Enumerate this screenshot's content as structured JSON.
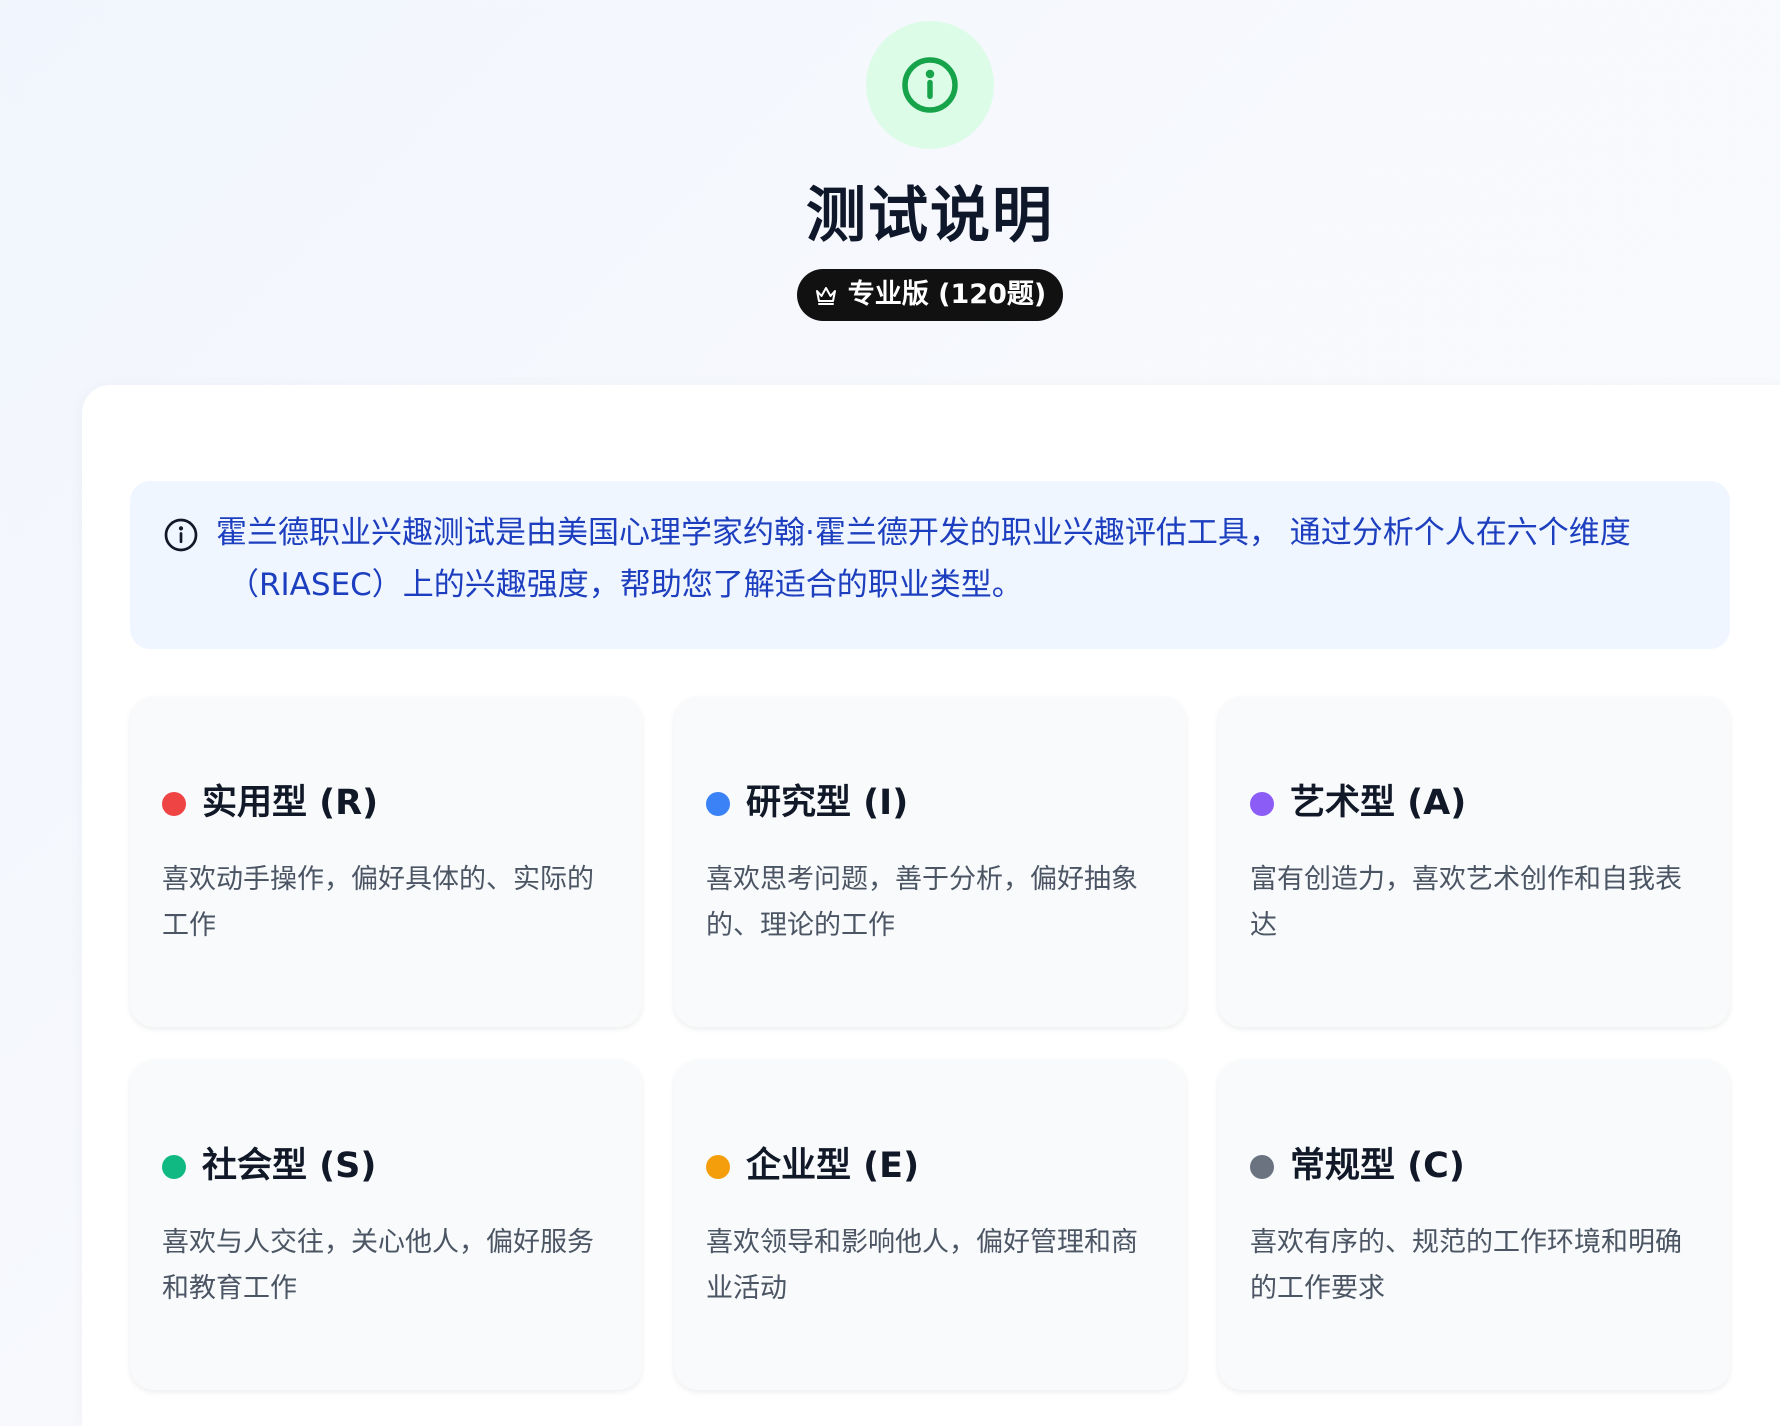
{
  "header": {
    "icon": "info-circle-icon",
    "title": "测试说明",
    "badge_icon": "crown-icon",
    "badge_label": "专业版 (120题)"
  },
  "intro": {
    "icon": "info-circle-icon",
    "line1": "霍兰德职业兴趣测试是由美国心理学家约翰·霍兰德开发的职业兴趣评估工具， 通过分析个人在六个维度",
    "line2": "（RIASEC）上的兴趣强度，帮助您了解适合的职业类型。"
  },
  "colors": {
    "R": "#ef4444",
    "I": "#3b82f6",
    "A": "#8b5cf6",
    "S": "#10b981",
    "E": "#f59e0b",
    "C": "#6b7280"
  },
  "types": [
    {
      "code": "R",
      "title": "实用型 (R)",
      "description": "喜欢动手操作，偏好具体的、实际的工作"
    },
    {
      "code": "I",
      "title": "研究型 (I)",
      "description": "喜欢思考问题，善于分析，偏好抽象的、理论的工作"
    },
    {
      "code": "A",
      "title": "艺术型 (A)",
      "description": "富有创造力，喜欢艺术创作和自我表达"
    },
    {
      "code": "S",
      "title": "社会型 (S)",
      "description": "喜欢与人交往，关心他人，偏好服务和教育工作"
    },
    {
      "code": "E",
      "title": "企业型 (E)",
      "description": "喜欢领导和影响他人，偏好管理和商业活动"
    },
    {
      "code": "C",
      "title": "常规型 (C)",
      "description": "喜欢有序的、规范的工作环境和明确的工作要求"
    }
  ]
}
